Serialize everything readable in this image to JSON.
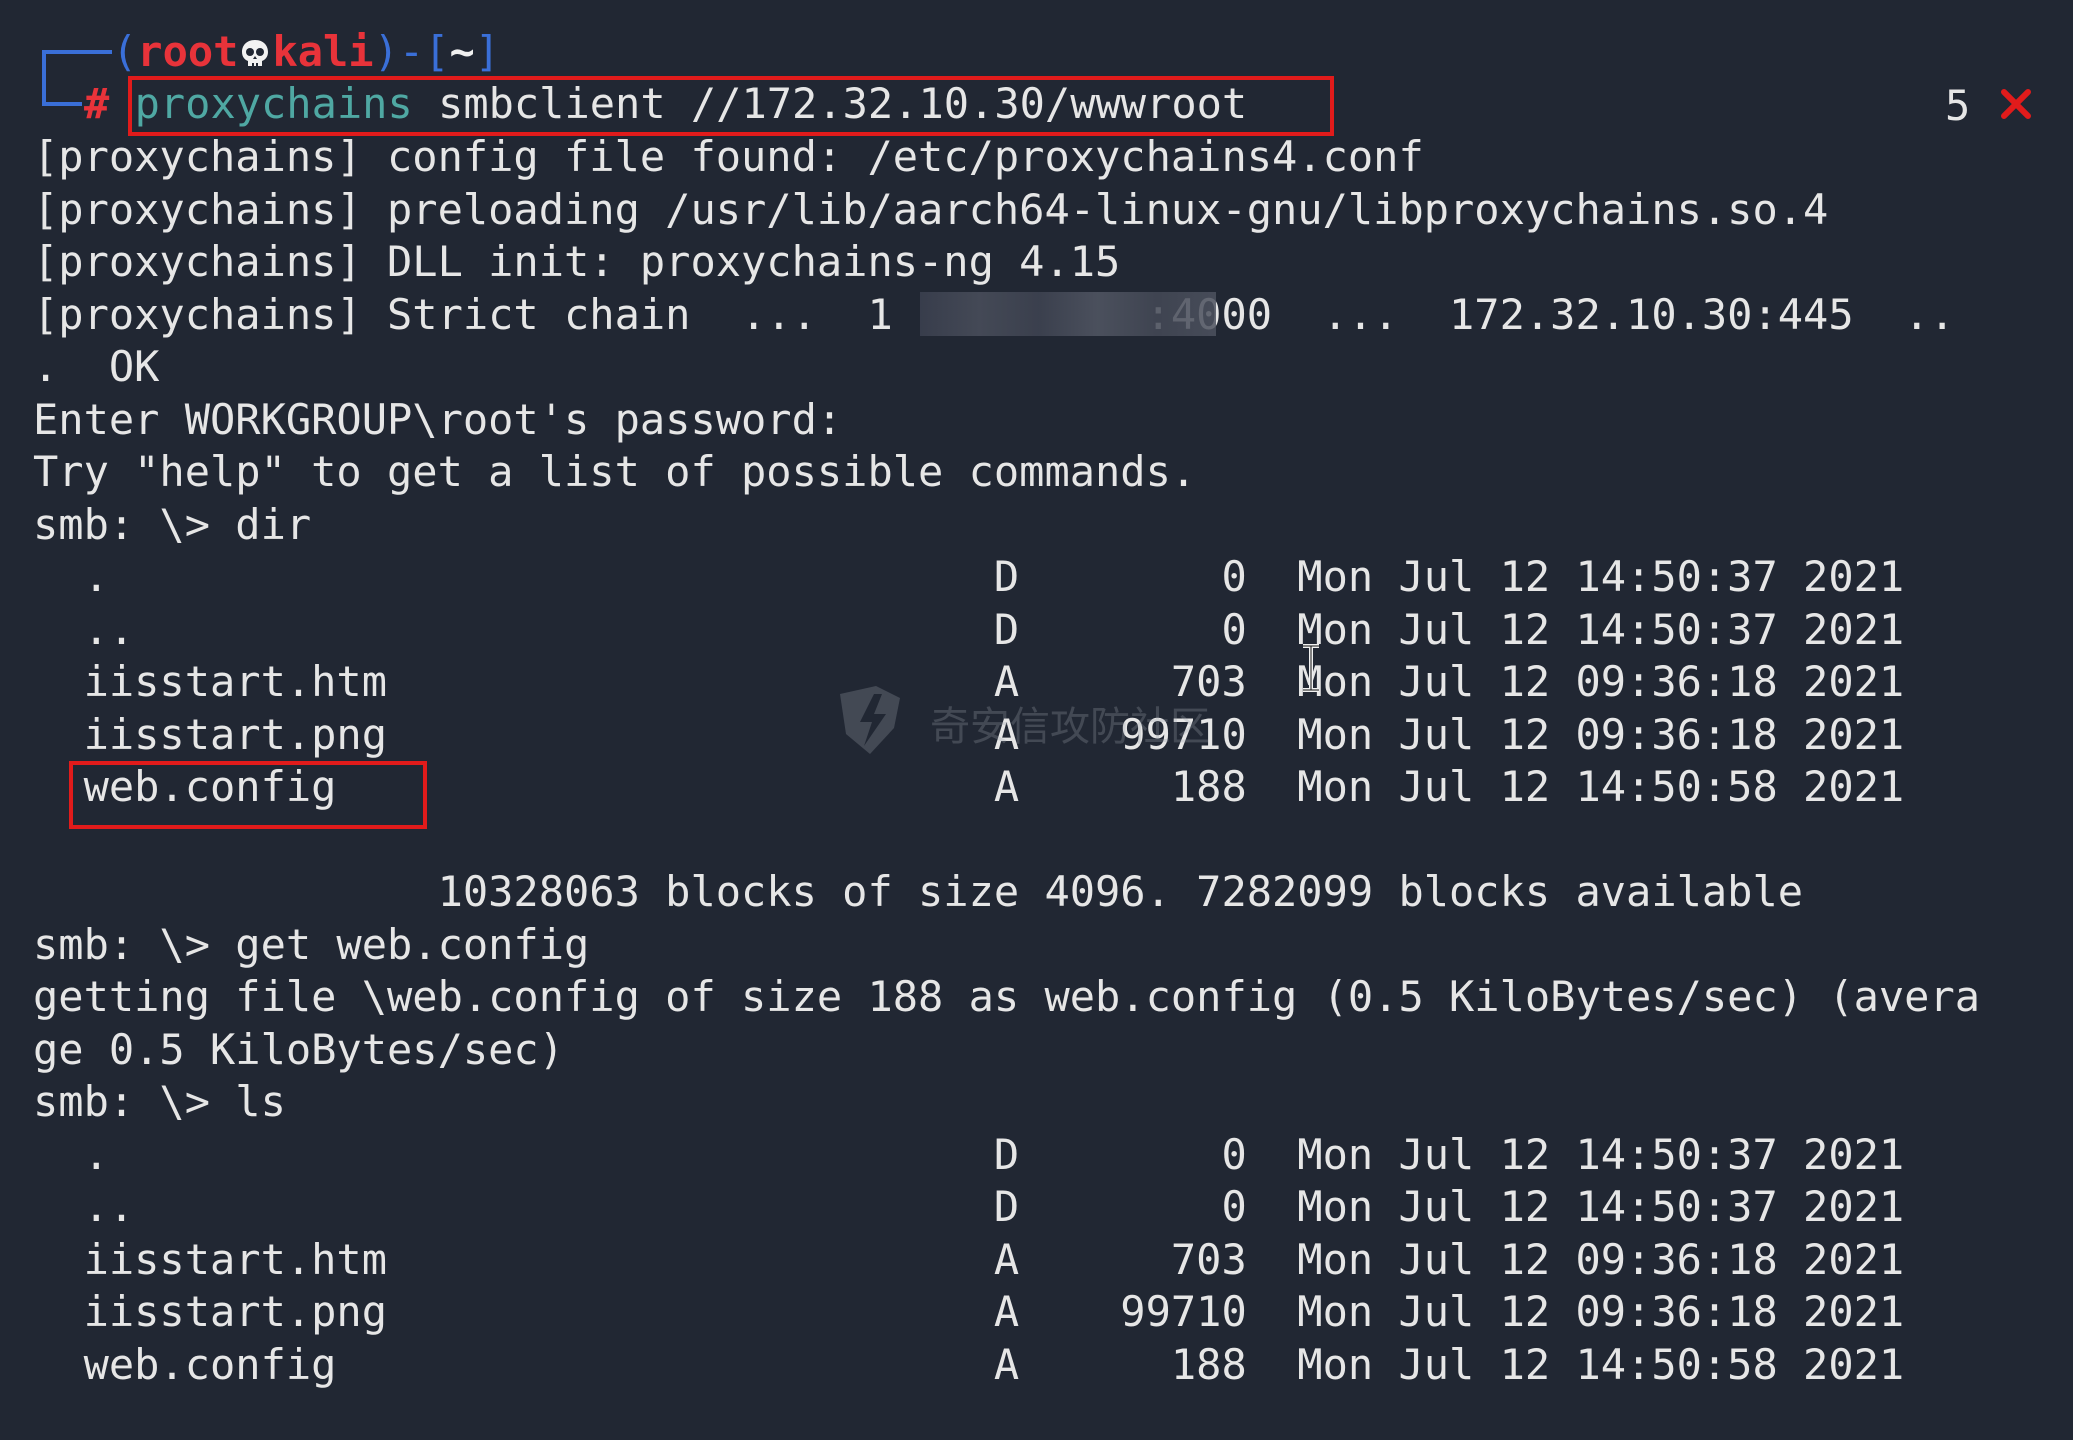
{
  "prompt": {
    "open": "(",
    "user": "root",
    "host": "kali",
    "mid": ")-[",
    "cwd": "~",
    "close": "]",
    "symbol": "#",
    "cmd_name": "proxychains",
    "cmd_args": " smbclient //172.32.10.30/wwwroot",
    "counter": "5",
    "status_icon": "close-icon"
  },
  "lines": [
    "[proxychains] config file found: /etc/proxychains4.conf",
    "[proxychains] preloading /usr/lib/aarch64-linux-gnu/libproxychains.so.4",
    "[proxychains] DLL init: proxychains-ng 4.15",
    "[proxychains] Strict chain  ...  1          :4000  ...  172.32.10.30:445  ..",
    ".  OK",
    "Enter WORKGROUP\\root's password:",
    "Try \"help\" to get a list of possible commands.",
    "smb: \\> dir",
    "  .                                   D        0  Mon Jul 12 14:50:37 2021",
    "  ..                                  D        0  Mon Jul 12 14:50:37 2021",
    "  iisstart.htm                        A      703  Mon Jul 12 09:36:18 2021",
    "  iisstart.png                        A    99710  Mon Jul 12 09:36:18 2021",
    "  web.config                          A      188  Mon Jul 12 14:50:58 2021",
    "",
    "                10328063 blocks of size 4096. 7282099 blocks available",
    "smb: \\> get web.config",
    "getting file \\web.config of size 188 as web.config (0.5 KiloBytes/sec) (avera",
    "ge 0.5 KiloBytes/sec)",
    "smb: \\> ls",
    "  .                                   D        0  Mon Jul 12 14:50:37 2021",
    "  ..                                  D        0  Mon Jul 12 14:50:37 2021",
    "  iisstart.htm                        A      703  Mon Jul 12 09:36:18 2021",
    "  iisstart.png                        A    99710  Mon Jul 12 09:36:18 2021",
    "  web.config                          A      188  Mon Jul 12 14:50:58 2021"
  ],
  "watermark": "奇安信攻防社区",
  "colors": {
    "background": "#212733",
    "prompt_frame": "#3a6fd8",
    "prompt_user": "#e8333a",
    "command": "#4fa8a3",
    "highlight_box": "#e11b1b"
  }
}
